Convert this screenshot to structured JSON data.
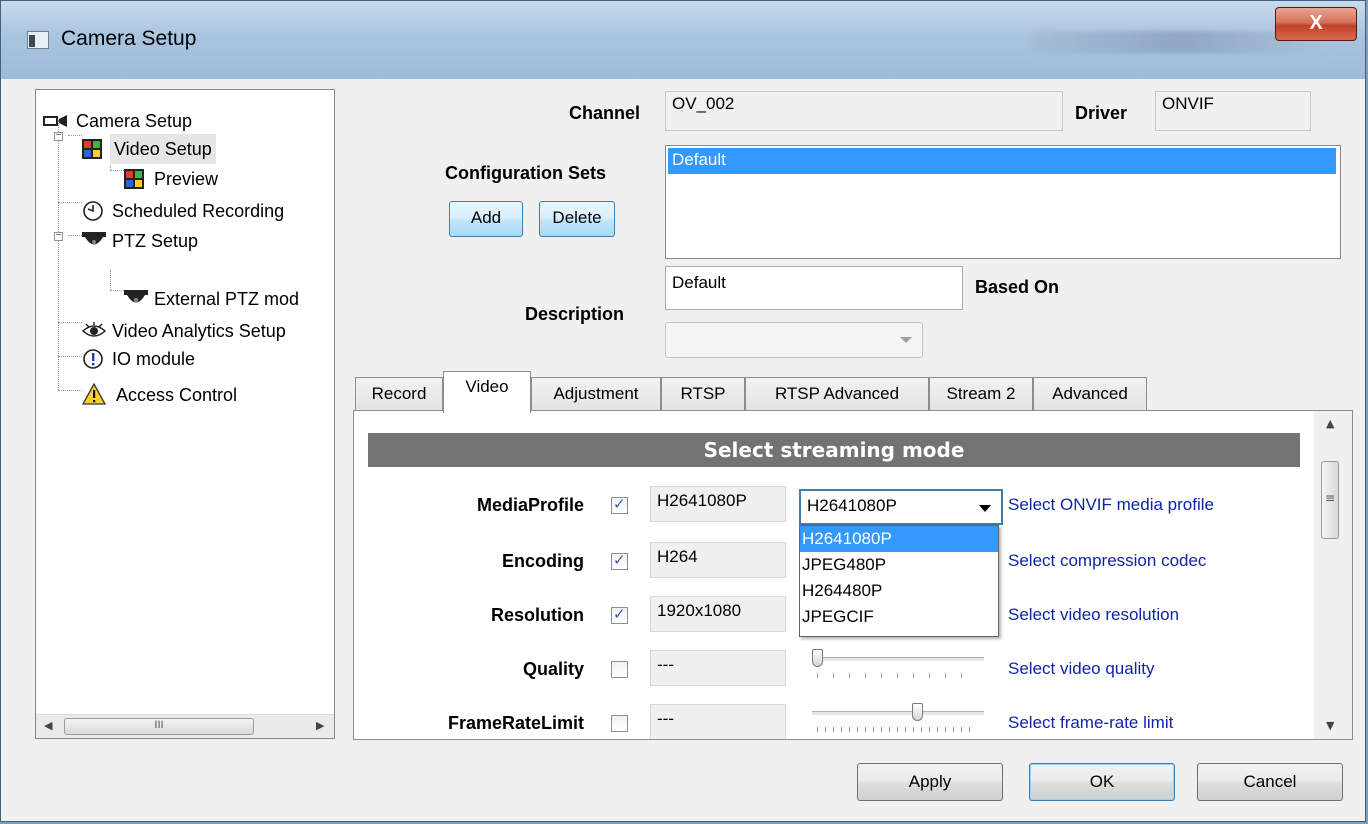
{
  "window": {
    "title": "Camera Setup",
    "close_label": "X"
  },
  "tree": {
    "items": [
      {
        "label": "Camera Setup",
        "icon": "camera-icon"
      },
      {
        "label": "Video Setup",
        "icon": "color-grid-icon",
        "expander": "−"
      },
      {
        "label": "Preview",
        "icon": "color-grid-icon"
      },
      {
        "label": "Scheduled Recording",
        "icon": "clock-icon"
      },
      {
        "label": "PTZ Setup",
        "icon": "dome-camera-icon",
        "expander": "−"
      },
      {
        "label": "External PTZ mod",
        "icon": "dome-camera-icon"
      },
      {
        "label": "Video Analytics Setup",
        "icon": "eye-icon"
      },
      {
        "label": "IO module",
        "icon": "info-icon"
      },
      {
        "label": "Access Control",
        "icon": "warning-icon"
      }
    ],
    "hscroll_grip": "III",
    "hscroll_left": "◀",
    "hscroll_right": "▶"
  },
  "header": {
    "channel_label": "Channel",
    "channel_value": "OV_002",
    "driver_label": "Driver",
    "driver_value": "ONVIF",
    "config_sets_label": "Configuration Sets",
    "add_label": "Add",
    "delete_label": "Delete",
    "config_sets": [
      "Default"
    ],
    "description_label": "Description",
    "description_value": "Default",
    "based_on_label": "Based On"
  },
  "tabs": [
    "Record",
    "Video",
    "Adjustment",
    "RTSP",
    "RTSP Advanced",
    "Stream 2",
    "Advanced"
  ],
  "active_tab": "Video",
  "video": {
    "section_title": "Select streaming mode",
    "rows": [
      {
        "label": "MediaProfile",
        "checked": true,
        "value": "H2641080P",
        "desc": "Select ONVIF media profile"
      },
      {
        "label": "Encoding",
        "checked": true,
        "value": "H264",
        "desc": "Select compression codec"
      },
      {
        "label": "Resolution",
        "checked": true,
        "value": "1920x1080",
        "desc": "Select video resolution"
      },
      {
        "label": "Quality",
        "checked": false,
        "value": "---",
        "desc": "Select video quality"
      },
      {
        "label": "FrameRateLimit",
        "checked": false,
        "value": "---",
        "desc": "Select frame-rate limit"
      }
    ],
    "profile_combo_value": "H2641080P",
    "profile_options": [
      "H2641080P",
      "JPEG480P",
      "H264480P",
      "JPEGCIF"
    ],
    "profile_highlighted": "H2641080P",
    "quality_slider_level": 0.0,
    "framerate_slider_level": 0.62,
    "scroll_up": "▲",
    "scroll_down": "▼",
    "scroll_grip": "≡"
  },
  "footer": {
    "apply_label": "Apply",
    "ok_label": "OK",
    "cancel_label": "Cancel"
  },
  "colors": {
    "selection": "#3399ff",
    "link_text": "#0f25a6",
    "section_header": "#737373"
  }
}
